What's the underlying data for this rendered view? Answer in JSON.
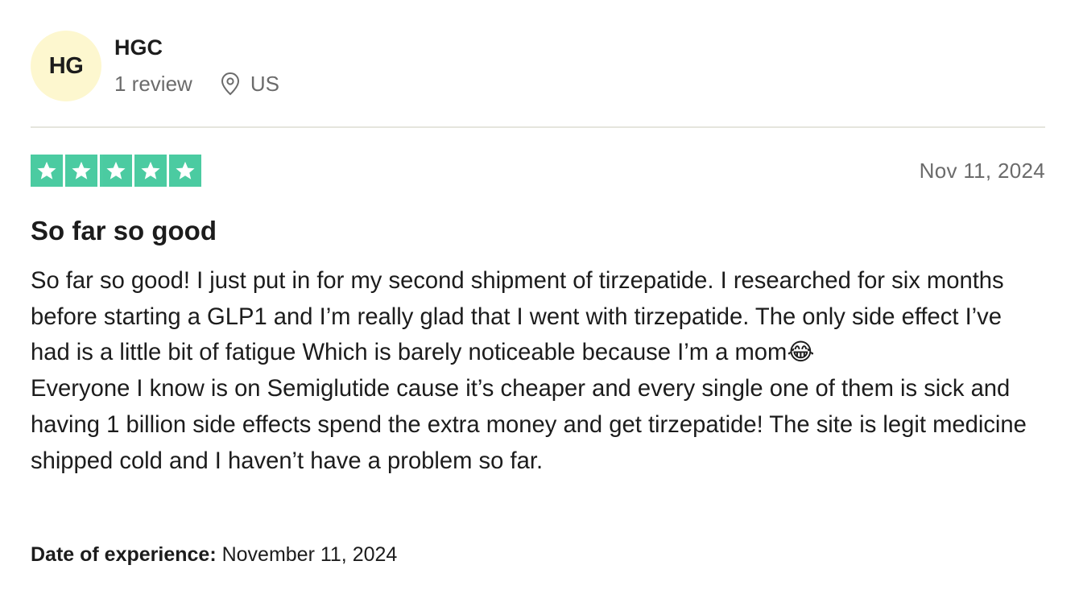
{
  "reviewer": {
    "initials": "HG",
    "name": "HGC",
    "review_count": "1 review",
    "location": "US",
    "avatar_color": "#fdf7cf"
  },
  "review": {
    "rating": 5,
    "max_rating": 5,
    "star_color": "#00b67a",
    "date": "Nov 11, 2024",
    "title": "So far so good",
    "body_line_1": "So far so good! I just put in for my second shipment of tirzepatide. I researched for six months before starting a GLP1 and I’m really glad that I went with tirzepatide. The only side effect I’ve had is a little bit of fatigue Which is barely noticeable because I’m a mom😂",
    "body_line_2": "Everyone I know is on Semiglutide cause it’s cheaper and every single one of them is sick and having 1 billion side effects spend the extra money and get tirzepatide! The site is legit medicine shipped cold and I haven’t have a problem so far.",
    "experience_label": "Date of experience:",
    "experience_date": " November 11, 2024"
  },
  "icons": {
    "location": "map-pin-icon",
    "star": "star-icon"
  }
}
